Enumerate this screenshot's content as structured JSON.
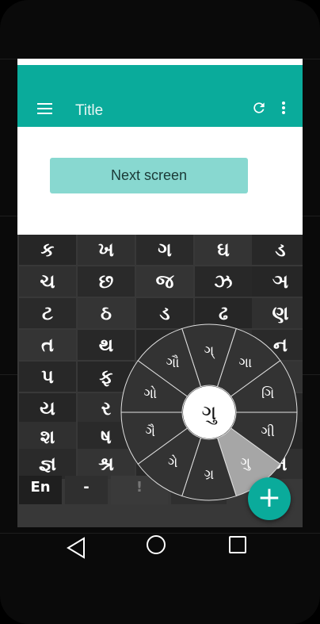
{
  "app": {
    "title": "Title"
  },
  "main": {
    "next_button_label": "Next screen"
  },
  "keyboard": {
    "rows": [
      [
        "ક",
        "ખ",
        "ગ",
        "ઘ",
        "ડ"
      ],
      [
        "ચ",
        "છ",
        "જ",
        "ઝ",
        "ઞ"
      ],
      [
        "ટ",
        "ઠ",
        "ડ",
        "ઢ",
        "ણ"
      ],
      [
        "ત",
        "થ",
        "",
        "",
        "ન"
      ],
      [
        "પ",
        "ફ",
        "",
        "",
        ""
      ],
      [
        "ય",
        "ર",
        "",
        "",
        ""
      ],
      [
        "શ",
        "ષ",
        "",
        "",
        ""
      ],
      [
        "જ્ઞ",
        "શ્ર",
        "",
        "",
        "મ"
      ]
    ],
    "bottom": {
      "lang": "En",
      "dash": "-",
      "exclaim": "!"
    }
  },
  "wheel": {
    "center": "ગુ",
    "options": [
      "ગ્",
      "ગા",
      "ગિ",
      "ગી",
      "ગુ",
      "ગ્ર",
      "ગે",
      "ગૈ",
      "ગો",
      "ગૌ"
    ],
    "selected_index": 4
  },
  "fab": {
    "label": "+"
  },
  "colors": {
    "accent": "#0aab9b",
    "keyboard_bg": "#383838",
    "button_bg": "#88d8d0"
  }
}
